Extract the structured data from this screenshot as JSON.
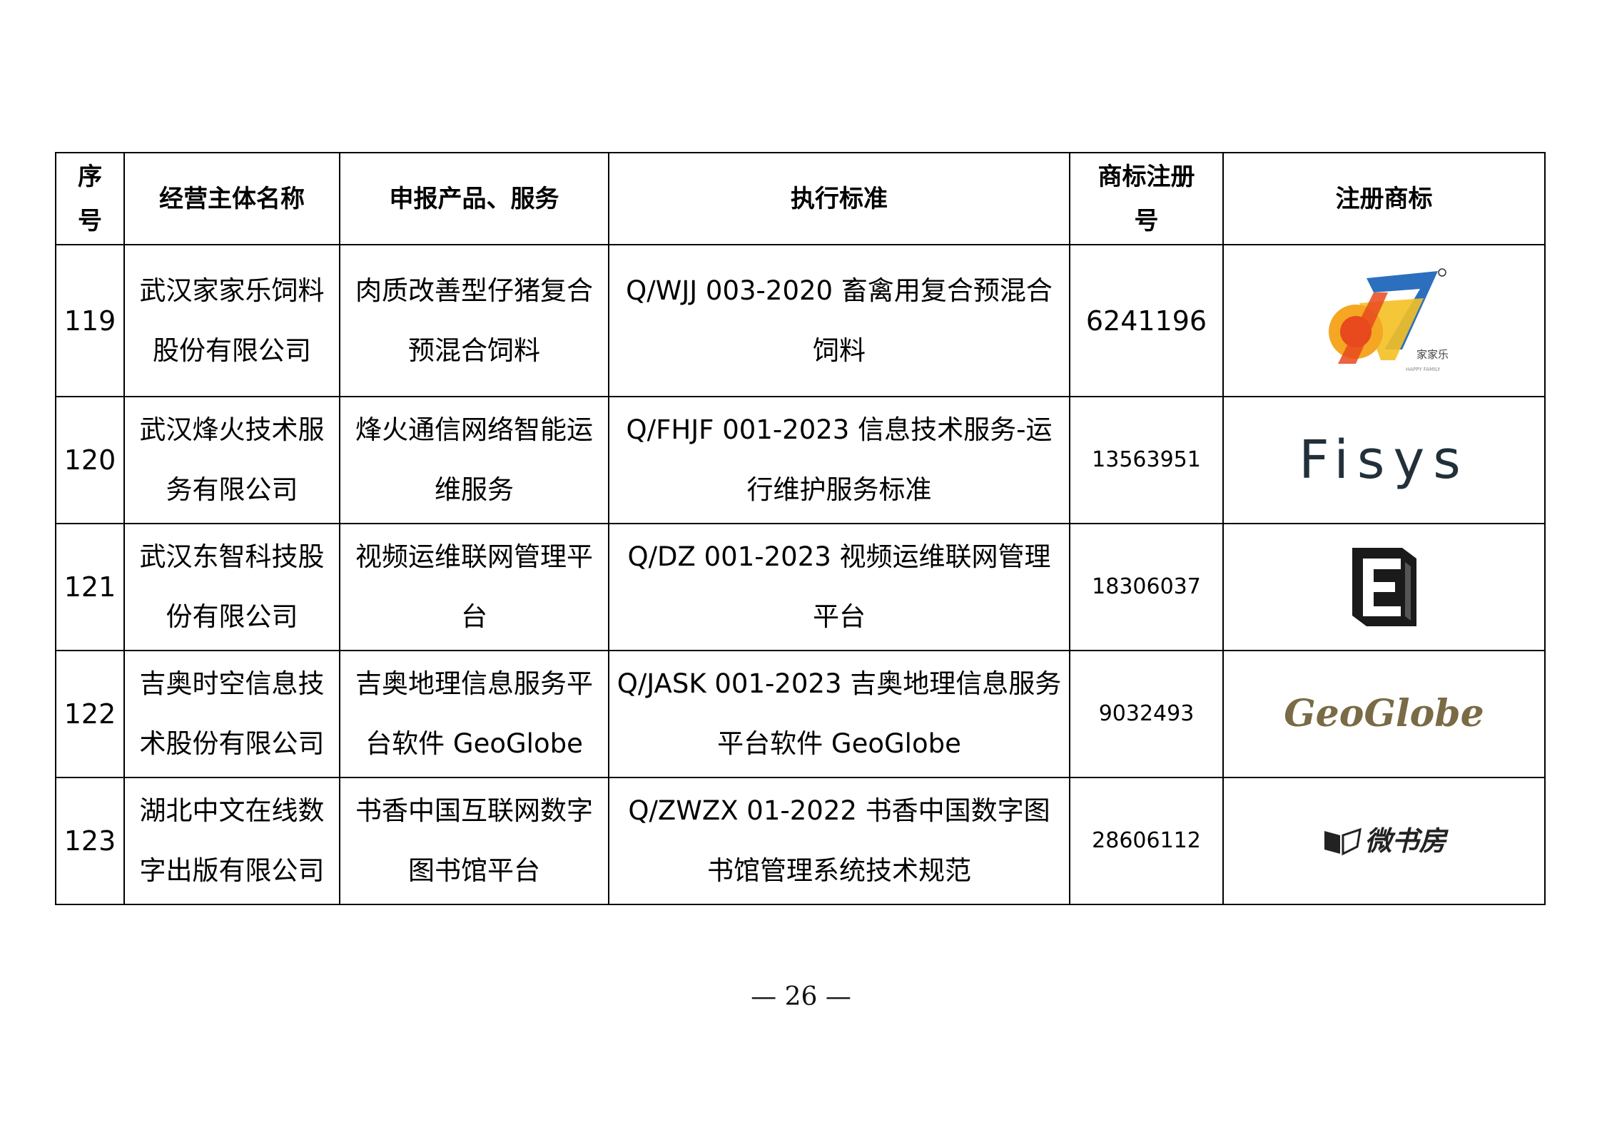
{
  "table": {
    "headers": {
      "no": "序\n号",
      "entity": "经营主体名称",
      "product": "申报产品、服务",
      "standard": "执行标准",
      "regno": "商标注册\n号",
      "trademark": "注册商标"
    },
    "rows": [
      {
        "no": "119",
        "entity": "武汉家家乐饲料股份有限公司",
        "product": "肉质改善型仔猪复合预混合饲料",
        "standard": "Q/WJJ 003-2020 畜禽用复合预混合饲料",
        "regno": "6241196",
        "logo_name": "jiajiale-logo",
        "logo_text": "家家乐",
        "logo_subtext": "HAPPY FAMILY",
        "logo_colors": [
          "#f5a623",
          "#e8491d",
          "#2c6fbf"
        ]
      },
      {
        "no": "120",
        "entity": "武汉烽火技术服务有限公司",
        "product": "烽火通信网络智能运维服务",
        "standard": "Q/FHJF 001-2023 信息技术服务-运行维护服务标准",
        "regno": "13563951",
        "logo_name": "fisys-logo",
        "logo_text": "Fisys"
      },
      {
        "no": "121",
        "entity": "武汉东智科技股份有限公司",
        "product": "视频运维联网管理平台",
        "standard": "Q/DZ 001-2023 视频运维联网管理平台",
        "regno": "18306037",
        "logo_name": "dongzhi-logo"
      },
      {
        "no": "122",
        "entity": "吉奥时空信息技术股份有限公司",
        "product": "吉奥地理信息服务平台软件 GeoGlobe",
        "standard": "Q/JASK 001-2023 吉奥地理信息服务平台软件 GeoGlobe",
        "regno": "9032493",
        "logo_name": "geoglobe-logo",
        "logo_text": "GeoGlobe"
      },
      {
        "no": "123",
        "entity": "湖北中文在线数字出版有限公司",
        "product": "书香中国互联网数字图书馆平台",
        "standard": "Q/ZWZX 01-2022 书香中国数字图书馆管理系统技术规范",
        "regno": "28606112",
        "logo_name": "weishufang-logo",
        "logo_text": "微书房"
      }
    ]
  },
  "footer": {
    "page_number": "— 26 —"
  }
}
